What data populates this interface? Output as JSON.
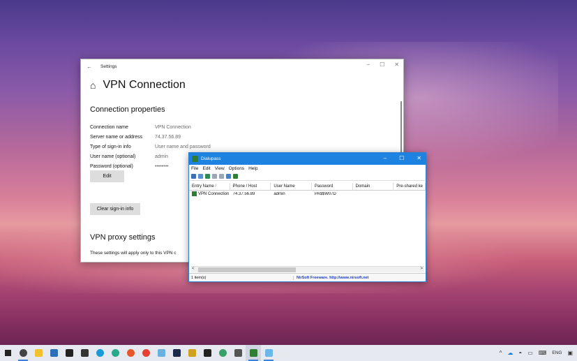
{
  "settings": {
    "app_title": "Settings",
    "page_title": "VPN Connection",
    "section_title": "Connection properties",
    "properties": [
      {
        "label": "Connection name",
        "value": "VPN Connection"
      },
      {
        "label": "Server name or address",
        "value": "74.37.56.89"
      },
      {
        "label": "Type of sign-in info",
        "value": "User name and password"
      },
      {
        "label": "User name (optional)",
        "value": "admin"
      },
      {
        "label": "Password (optional)",
        "value": "••••••••"
      }
    ],
    "edit_label": "Edit",
    "clear_label": "Clear sign-in info",
    "proxy_title": "VPN proxy settings",
    "proxy_text": "These settings will apply only to this VPN c",
    "minimize": "–",
    "maximize": "☐",
    "close": "✕"
  },
  "dialupass": {
    "title": "Dialupass",
    "menu": [
      "File",
      "Edit",
      "View",
      "Options",
      "Help"
    ],
    "columns": [
      "Entry Name",
      "Phone / Host",
      "User Name",
      "Password",
      "Domain",
      "Pre-shared ke"
    ],
    "sort_indicator": "/",
    "rows": [
      {
        "entry": "VPN Connection",
        "host": "74.37.56.89",
        "user": "admin",
        "password": "PA$$W07D",
        "domain": "",
        "psk": ""
      }
    ],
    "status_items": "1 item(s)",
    "status_credit": "NirSoft Freeware.  http://www.nirsoft.net",
    "minimize": "–",
    "maximize": "☐",
    "close": "✕"
  },
  "taskbar": {
    "tray_lang": "ENG",
    "tray_chevron": "^"
  },
  "colors": {
    "accent": "#1e82e0",
    "taskbar_bg": "#e6eaf0"
  }
}
